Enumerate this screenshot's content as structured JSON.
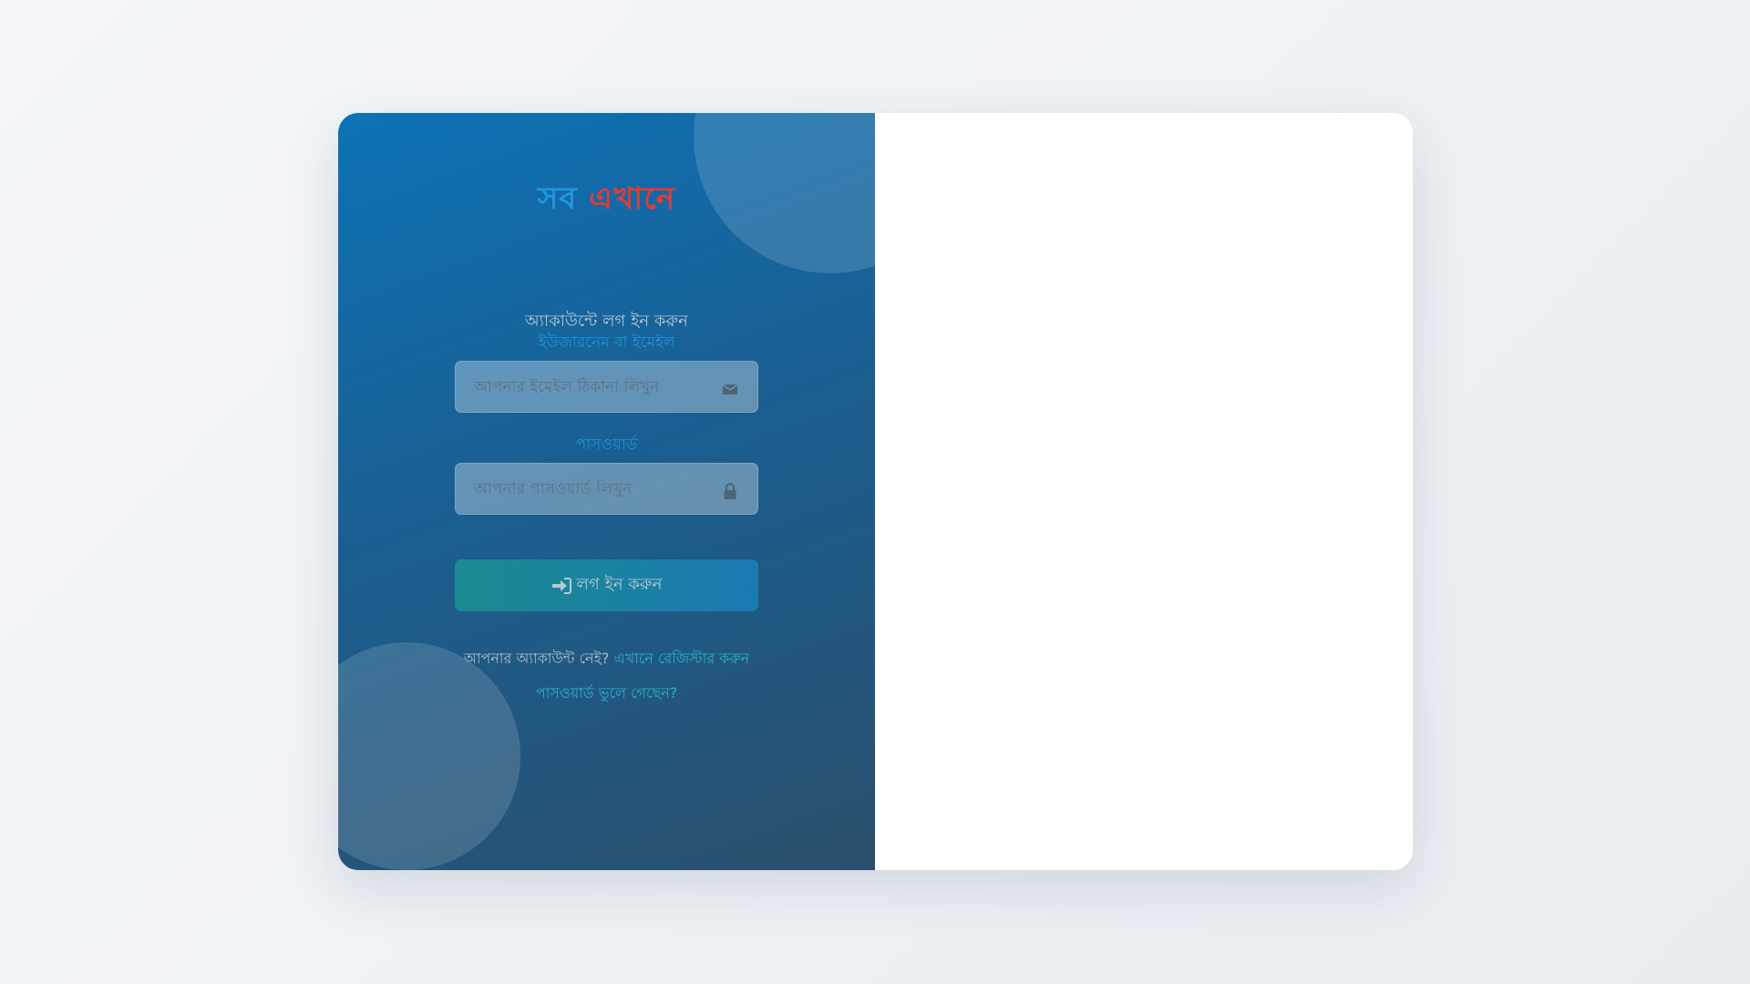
{
  "logo": {
    "word1": "সব",
    "word2": "এখানে",
    "color1": "#2196e0",
    "color2": "#e53935"
  },
  "login_form": {
    "title": "অ্যাকাউন্টে লগ ইন করুন",
    "username_label": "ইউজারনেম বা ইমেইল",
    "username_placeholder": "আপনার ইমেইল ঠিকানা লিখুন",
    "username_icon": "envelope-icon",
    "password_label": "পাসওয়ার্ড",
    "password_placeholder": "আপনার পাসওয়ার্ড লিখুন",
    "password_icon": "lock-icon",
    "submit_icon": "sign-in-icon",
    "submit_label": "লগ ইন করুন",
    "no_account_text": "আপনার অ্যাকাউন্ট নেই?",
    "register_link": "এখানে রেজিস্টার করুন",
    "forgot_link": "পাসওয়ার্ড ভুলে গেছেন?"
  },
  "colors": {
    "panel_gradient_start": "#0d72b6",
    "panel_gradient_end": "#2a4f6c",
    "accent_label": "#1e93d6",
    "link": "#26b4c7"
  }
}
